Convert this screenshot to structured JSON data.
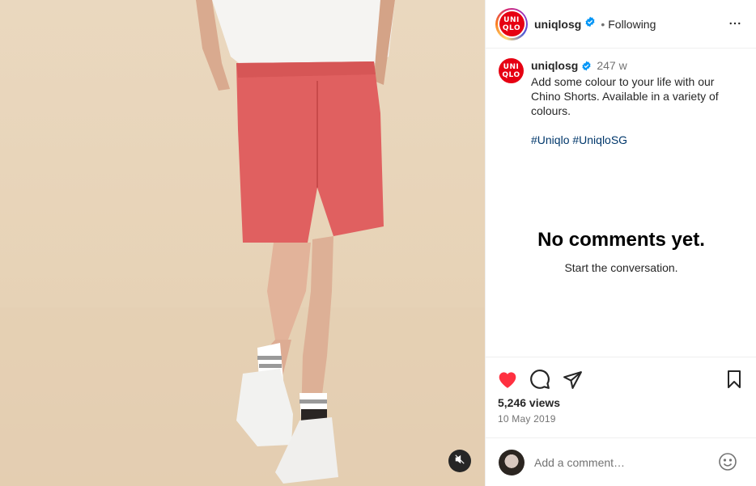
{
  "post": {
    "username": "uniqlosg",
    "follow_status": "Following",
    "separator": "•",
    "logo_text_line1": "UNI",
    "logo_text_line2": "QLO",
    "caption_time": "247 w",
    "caption_text": "Add some colour to your life with our Chino Shorts. Available in a variety of colours.",
    "hashtags": "#Uniqlo #UniqloSG",
    "views": "5,246 views",
    "date": "10 May 2019"
  },
  "comments": {
    "empty_title": "No comments yet.",
    "empty_sub": "Start the conversation.",
    "input_placeholder": "Add a comment…"
  },
  "icons": {
    "like": "heart-icon",
    "comment": "comment-icon",
    "share": "share-icon",
    "save": "bookmark-icon",
    "more": "more-icon",
    "mute": "speaker-muted-icon",
    "verified": "verified-badge-icon",
    "emoji": "emoji-icon"
  },
  "colors": {
    "brand_red": "#e60012",
    "liked_red": "#ff3040",
    "hashtag_link": "#00376b",
    "verified_blue": "#0095f6"
  }
}
